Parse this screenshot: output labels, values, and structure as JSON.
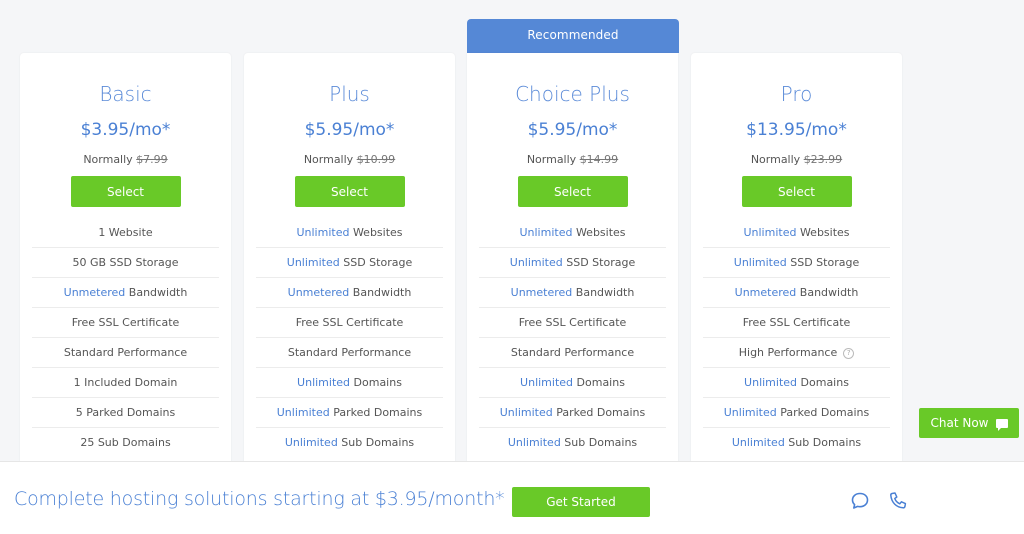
{
  "recommended_label": "Recommended",
  "plans": [
    {
      "name": "Basic",
      "price": "$3.95/mo*",
      "normally_label": "Normally",
      "normal_price": "$7.99",
      "select_label": "Select",
      "features": [
        {
          "hl": "",
          "text": "1 Website"
        },
        {
          "hl": "",
          "text": "50 GB SSD Storage"
        },
        {
          "hl": "Unmetered",
          "text": " Bandwidth"
        },
        {
          "hl": "",
          "text": "Free SSL Certificate"
        },
        {
          "hl": "",
          "text": "Standard Performance"
        },
        {
          "hl": "",
          "text": "1 Included Domain"
        },
        {
          "hl": "",
          "text": "5 Parked Domains"
        },
        {
          "hl": "",
          "text": "25 Sub Domains"
        }
      ]
    },
    {
      "name": "Plus",
      "price": "$5.95/mo*",
      "normally_label": "Normally",
      "normal_price": "$10.99",
      "select_label": "Select",
      "features": [
        {
          "hl": "Unlimited",
          "text": " Websites"
        },
        {
          "hl": "Unlimited",
          "text": " SSD Storage"
        },
        {
          "hl": "Unmetered",
          "text": " Bandwidth"
        },
        {
          "hl": "",
          "text": "Free SSL Certificate"
        },
        {
          "hl": "",
          "text": "Standard Performance"
        },
        {
          "hl": "Unlimited",
          "text": " Domains"
        },
        {
          "hl": "Unlimited",
          "text": " Parked Domains"
        },
        {
          "hl": "Unlimited",
          "text": " Sub Domains"
        }
      ]
    },
    {
      "name": "Choice Plus",
      "price": "$5.95/mo*",
      "normally_label": "Normally",
      "normal_price": "$14.99",
      "select_label": "Select",
      "features": [
        {
          "hl": "Unlimited",
          "text": " Websites"
        },
        {
          "hl": "Unlimited",
          "text": " SSD Storage"
        },
        {
          "hl": "Unmetered",
          "text": " Bandwidth"
        },
        {
          "hl": "",
          "text": "Free SSL Certificate"
        },
        {
          "hl": "",
          "text": "Standard Performance"
        },
        {
          "hl": "Unlimited",
          "text": " Domains"
        },
        {
          "hl": "Unlimited",
          "text": " Parked Domains"
        },
        {
          "hl": "Unlimited",
          "text": " Sub Domains"
        }
      ]
    },
    {
      "name": "Pro",
      "price": "$13.95/mo*",
      "normally_label": "Normally",
      "normal_price": "$23.99",
      "select_label": "Select",
      "features": [
        {
          "hl": "Unlimited",
          "text": " Websites"
        },
        {
          "hl": "Unlimited",
          "text": " SSD Storage"
        },
        {
          "hl": "Unmetered",
          "text": " Bandwidth"
        },
        {
          "hl": "",
          "text": "Free SSL Certificate"
        },
        {
          "hl": "",
          "text": "High Performance",
          "help": "?"
        },
        {
          "hl": "Unlimited",
          "text": " Domains"
        },
        {
          "hl": "Unlimited",
          "text": " Parked Domains"
        },
        {
          "hl": "Unlimited",
          "text": " Sub Domains"
        }
      ]
    }
  ],
  "chat_now_label": "Chat Now",
  "footer": {
    "text": "Complete hosting solutions starting at $3.95/month*",
    "cta_label": "Get Started",
    "icons": [
      "chat-icon",
      "phone-icon"
    ]
  },
  "colors": {
    "accent_blue": "#4a80d4",
    "badge_blue": "#5588d6",
    "button_green": "#69c928"
  }
}
